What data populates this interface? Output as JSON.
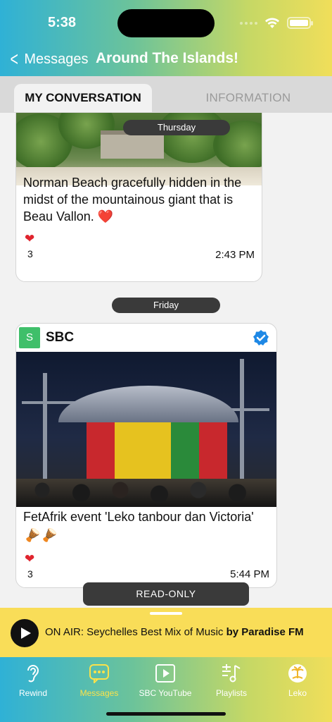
{
  "status": {
    "time": "5:38"
  },
  "nav": {
    "back_label": "Messages",
    "title": "Around The Islands!"
  },
  "tabs": [
    {
      "label": "MY CONVERSATION",
      "active": true
    },
    {
      "label": "INFORMATION",
      "active": false
    }
  ],
  "feed": {
    "day_labels": [
      "Thursday",
      "Friday"
    ],
    "posts": [
      {
        "caption": "Norman Beach gracefully hidden in the midst of the mountainous giant that is Beau Vallon. ❤️",
        "likes": "3",
        "time": "2:43 PM"
      },
      {
        "sender_initial": "S",
        "sender_name": "SBC",
        "caption": "FetAfrik event 'Leko tanbour dan Victoria'",
        "emoji": "🪘🪘",
        "likes": "3",
        "time": "5:44 PM"
      }
    ],
    "readonly_label": "READ-ONLY"
  },
  "player": {
    "prefix": "ON AIR: Seychelles Best Mix of Music ",
    "by": "by Paradise FM"
  },
  "tabbar": [
    {
      "label": "Rewind",
      "icon": "ear-icon"
    },
    {
      "label": "Messages",
      "icon": "chat-icon",
      "active": true
    },
    {
      "label": "SBC YouTube",
      "icon": "play-box-icon"
    },
    {
      "label": "Playlists",
      "icon": "playlist-icon"
    },
    {
      "label": "Leko",
      "icon": "island-logo-icon"
    }
  ],
  "colors": {
    "accent_active": "#fbe24a",
    "player_bg": "#f9dd58",
    "verified": "#1e88e5"
  }
}
